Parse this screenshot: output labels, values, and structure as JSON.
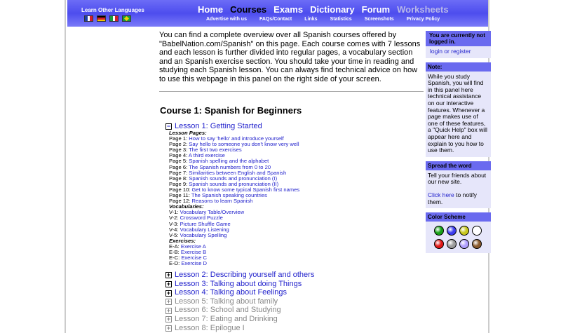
{
  "header": {
    "lang_title": "Learn Other Languages",
    "nav": [
      {
        "label": "Home",
        "state": "normal"
      },
      {
        "label": "Courses",
        "state": "active"
      },
      {
        "label": "Exams",
        "state": "normal"
      },
      {
        "label": "Dictionary",
        "state": "normal"
      },
      {
        "label": "Forum",
        "state": "normal"
      },
      {
        "label": "Worksheets",
        "state": "disabled"
      }
    ],
    "subnav": [
      "Advertise with us",
      "FAQs/Contact",
      "Links",
      "Statistics",
      "Screenshots",
      "Privacy Policy"
    ]
  },
  "main": {
    "intro": "You can find a complete overview over all Spanish courses offered by \"BabelNation.com/Spanish\" on this page. Each course comes with 7 lessons and each lesson is further divided into regular pages, a vocabulary section and an Spanish exercise section. You should take your time in reading and studying each Spanish lesson. You can always find technical advice on how to use this webpage in this panel on the right side of your screen.",
    "course_title": "Course 1: Spanish for Beginners",
    "lesson1": {
      "toggle": "−",
      "title": "Lesson 1: Getting Started",
      "pages_label": "Lesson Pages:",
      "pages": [
        {
          "prefix": "Page 1: ",
          "link": "How to say 'hello' and introduce yourself"
        },
        {
          "prefix": "Page 2: ",
          "link": "Say hello to someone you don't know very well"
        },
        {
          "prefix": "Page 3: ",
          "link": "The first two exercises"
        },
        {
          "prefix": "Page 4: ",
          "link": "A third exercise"
        },
        {
          "prefix": "Page 5: ",
          "link": "Spanish spelling and the alphabet"
        },
        {
          "prefix": "Page 6: ",
          "link": "The Spanish numbers from 0 to 20"
        },
        {
          "prefix": "Page 7: ",
          "link": "Similarities between English and Spanish"
        },
        {
          "prefix": "Page 8: ",
          "link": "Spanish sounds and pronunciation (I)"
        },
        {
          "prefix": "Page 9: ",
          "link": "Spanish sounds and pronunciation (II)"
        },
        {
          "prefix": "Page 10: ",
          "link": "Get to know some typical Spanish first names"
        },
        {
          "prefix": "Page 11: ",
          "link": "The Spanish speaking countries"
        },
        {
          "prefix": "Page 12: ",
          "link": "Reasons to learn Spanish"
        }
      ],
      "vocab_label": "Vocabularies:",
      "vocab": [
        {
          "prefix": "V-1: ",
          "link": "Vocabulary Table/Overview"
        },
        {
          "prefix": "V-2: ",
          "link": "Crossword Puzzle"
        },
        {
          "prefix": "V-3: ",
          "link": "Picture Shuffle Game"
        },
        {
          "prefix": "V-4: ",
          "link": "Vocabulary Listening"
        },
        {
          "prefix": "V-5: ",
          "link": "Vocabulary Spelling"
        }
      ],
      "exercises_label": "Exercises:",
      "exercises": [
        {
          "prefix": "E-A: ",
          "link": "Exercise A"
        },
        {
          "prefix": "E-B: ",
          "link": "Exercise B"
        },
        {
          "prefix": "E-C: ",
          "link": "Exercise C"
        },
        {
          "prefix": "E-D: ",
          "link": "Exercise D"
        }
      ]
    },
    "other_lessons": [
      {
        "toggle": "+",
        "title": "Lesson 2: Describing yourself and others",
        "active": true
      },
      {
        "toggle": "+",
        "title": "Lesson 3: Talking about doing Things",
        "active": true
      },
      {
        "toggle": "+",
        "title": "Lesson 4: Talking about Feelings",
        "active": true
      },
      {
        "toggle": "+",
        "title": "Lesson 5: Talking about family",
        "active": false
      },
      {
        "toggle": "+",
        "title": "Lesson 6: School and Studying",
        "active": false
      },
      {
        "toggle": "+",
        "title": "Lesson 7: Eating and Drinking",
        "active": false
      },
      {
        "toggle": "+",
        "title": "Lesson 8: Epilogue I",
        "active": false
      }
    ]
  },
  "sidebar": {
    "login_title": "You are currently not logged in.",
    "login_link": "login or register",
    "note_title": "Note:",
    "note_body": "While you study Spanish, you will find in this panel here technical assistance on our interactive features. Whenever a page makes use of one of these features, a \"Quick Help\" box will appear here and explain to you how to use them.",
    "spread_title": "Spread the word",
    "spread_body": "Tell your friends about our new site.",
    "spread_link": "Click here",
    "spread_suffix": " to notify them.",
    "color_title": "Color Scheme",
    "colors": [
      "#16a016",
      "#3c3cf0",
      "#c8c81e",
      "#ffffff",
      "#e01818",
      "#9c9c9c",
      "#b0a0ff",
      "#8a5a2e"
    ]
  }
}
